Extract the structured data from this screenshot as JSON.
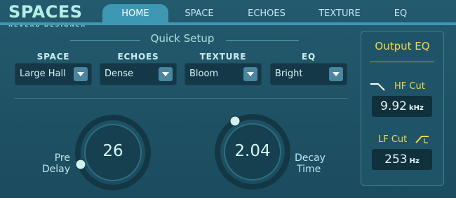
{
  "app": {
    "title": "SPACES",
    "subtitle": "REVERB DESIGNER"
  },
  "tabs": [
    {
      "label": "HOME",
      "active": true
    },
    {
      "label": "SPACE",
      "active": false
    },
    {
      "label": "ECHOES",
      "active": false
    },
    {
      "label": "TEXTURE",
      "active": false
    },
    {
      "label": "EQ",
      "active": false
    }
  ],
  "quick_setup": {
    "title": "Quick Setup",
    "dropdowns": [
      {
        "label": "SPACE",
        "value": "Large Hall"
      },
      {
        "label": "ECHOES",
        "value": "Dense"
      },
      {
        "label": "TEXTURE",
        "value": "Bloom"
      },
      {
        "label": "EQ",
        "value": "Bright"
      }
    ]
  },
  "knobs": {
    "pre_delay": {
      "label_line1": "Pre",
      "label_line2": "Delay",
      "value": "26"
    },
    "decay_time": {
      "label_line1": "Decay",
      "label_line2": "Time",
      "value": "2.04"
    }
  },
  "output_eq": {
    "title": "Output EQ",
    "hf_cut": {
      "label": "HF Cut",
      "value": "9.92",
      "unit": "kHz"
    },
    "lf_cut": {
      "label": "LF Cut",
      "value": "253",
      "unit": "Hz"
    }
  },
  "colors": {
    "accent": "#3e98b4",
    "eq_label": "#f0d84a",
    "brand": "#b6eee6"
  }
}
